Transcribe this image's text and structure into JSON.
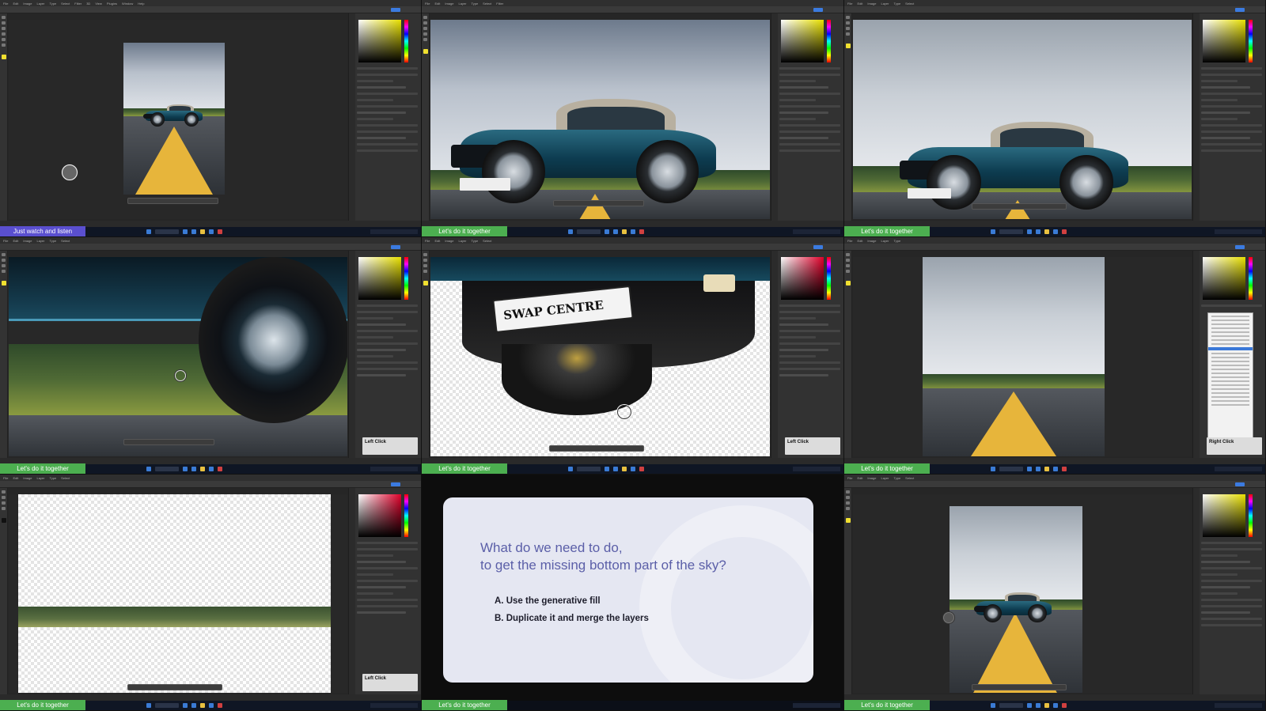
{
  "menu": [
    "File",
    "Edit",
    "Image",
    "Layer",
    "Type",
    "Select",
    "Filter",
    "3D",
    "View",
    "Plugins",
    "Window",
    "Help"
  ],
  "panel": {
    "click_left": "Left Click",
    "click_right": "Right Click"
  },
  "canvas": {
    "plate_text": "SWAP CENTRE"
  },
  "captions": {
    "tile1": "Just watch and listen",
    "tile2": "Let's do it together",
    "tile3": "Let's do it together",
    "tile4": "Let's do it together",
    "tile5": "Let's do it together",
    "tile6": "Let's do it together",
    "tile7": "Let's do it together",
    "tile8": "Let's do it together",
    "tile9": "Let's do it together"
  },
  "quiz": {
    "question_line1": "What do we need to do,",
    "question_line2": "to get the missing bottom part of the sky?",
    "option_a": "A. Use the generative fill",
    "option_b": "B. Duplicate it and merge the layers"
  },
  "colors": {
    "caption_green": "#4caf50",
    "caption_purple": "#5a4fcf",
    "road_line": "#e7b53b",
    "car_teal": "#0d3c50",
    "quiz_text": "#5b5fa8"
  }
}
